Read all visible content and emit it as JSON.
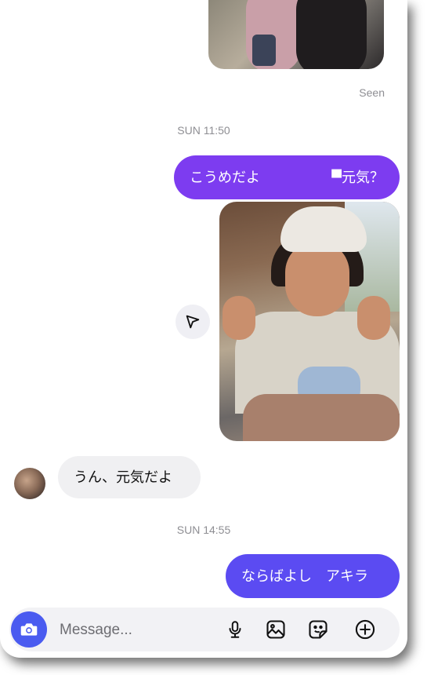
{
  "thread": {
    "seen_label": "Seen",
    "timestamp_1": "SUN 11:50",
    "timestamp_2": "SUN 14:55"
  },
  "messages": [
    {
      "side": "outgoing",
      "parts": [
        "こうめだよ",
        "▀元気？"
      ]
    },
    {
      "side": "outgoing",
      "type": "photo"
    },
    {
      "side": "incoming",
      "text": "うん、元気だよ"
    },
    {
      "side": "outgoing",
      "text": "ならばよし　アキラ"
    }
  ],
  "composer": {
    "placeholder": "Message...",
    "icons": [
      "camera-icon",
      "microphone-icon",
      "gallery-icon",
      "sticker-icon",
      "plus-icon"
    ]
  },
  "colors": {
    "outgoing_purple": "#7d3cf0",
    "outgoing_blue": "#5b4bf2",
    "incoming_gray": "#f0f0f2",
    "camera_button": "#4a5bf0"
  }
}
